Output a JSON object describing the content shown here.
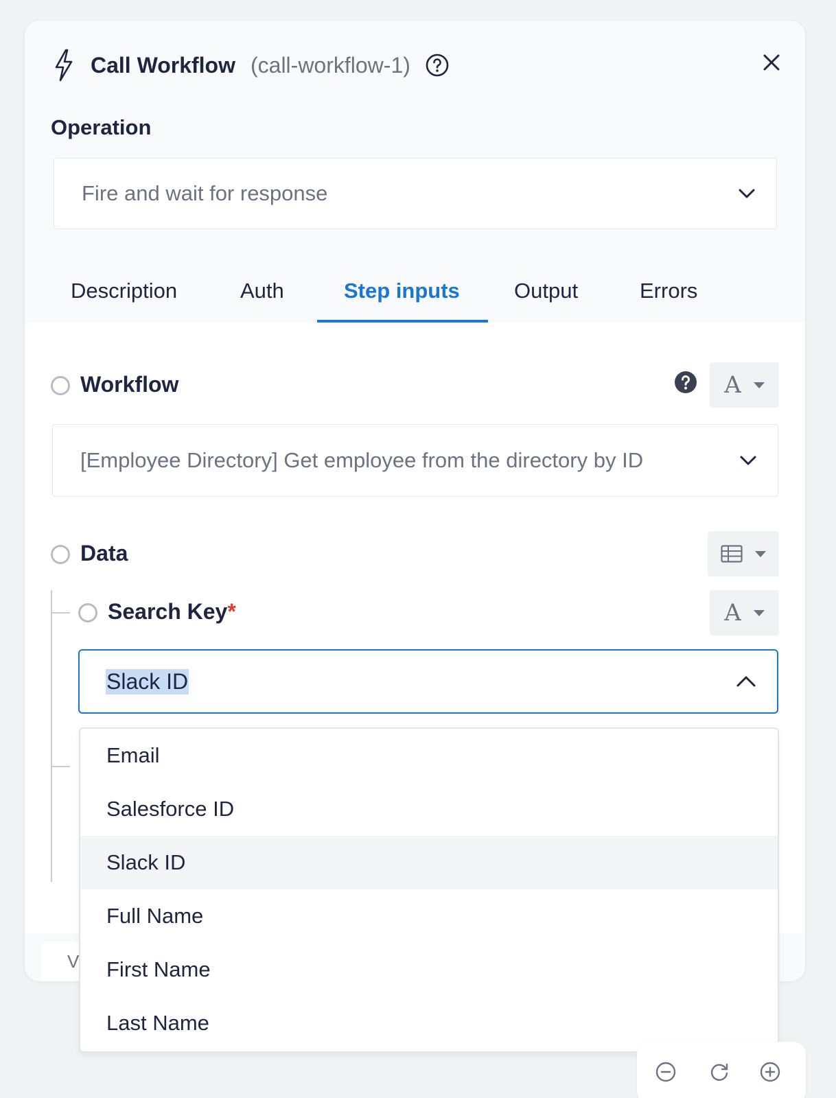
{
  "header": {
    "title": "Call Workflow",
    "subtitle": "(call-workflow-1)",
    "icon": "bolt-icon"
  },
  "operation": {
    "label": "Operation",
    "value": "Fire and wait for response"
  },
  "tabs": [
    {
      "label": "Description"
    },
    {
      "label": "Auth"
    },
    {
      "label": "Step inputs",
      "active": true
    },
    {
      "label": "Output"
    },
    {
      "label": "Errors"
    }
  ],
  "workflow": {
    "label": "Workflow",
    "type_label": "A",
    "value": "[Employee Directory] Get employee from the directory by ID"
  },
  "data": {
    "label": "Data",
    "type_icon": "table-icon"
  },
  "search_key": {
    "label": "Search Key",
    "required_mark": "*",
    "type_label": "A",
    "value": "Slack ID",
    "options": [
      "Email",
      "Salesforce ID",
      "Slack ID",
      "Full Name",
      "First Name",
      "Last Name"
    ],
    "selected": "Slack ID"
  },
  "footer": {
    "partial_text": "V"
  },
  "colors": {
    "accent": "#1976d2",
    "required": "#e53935",
    "text": "#1f2540",
    "muted": "#6b7280"
  }
}
